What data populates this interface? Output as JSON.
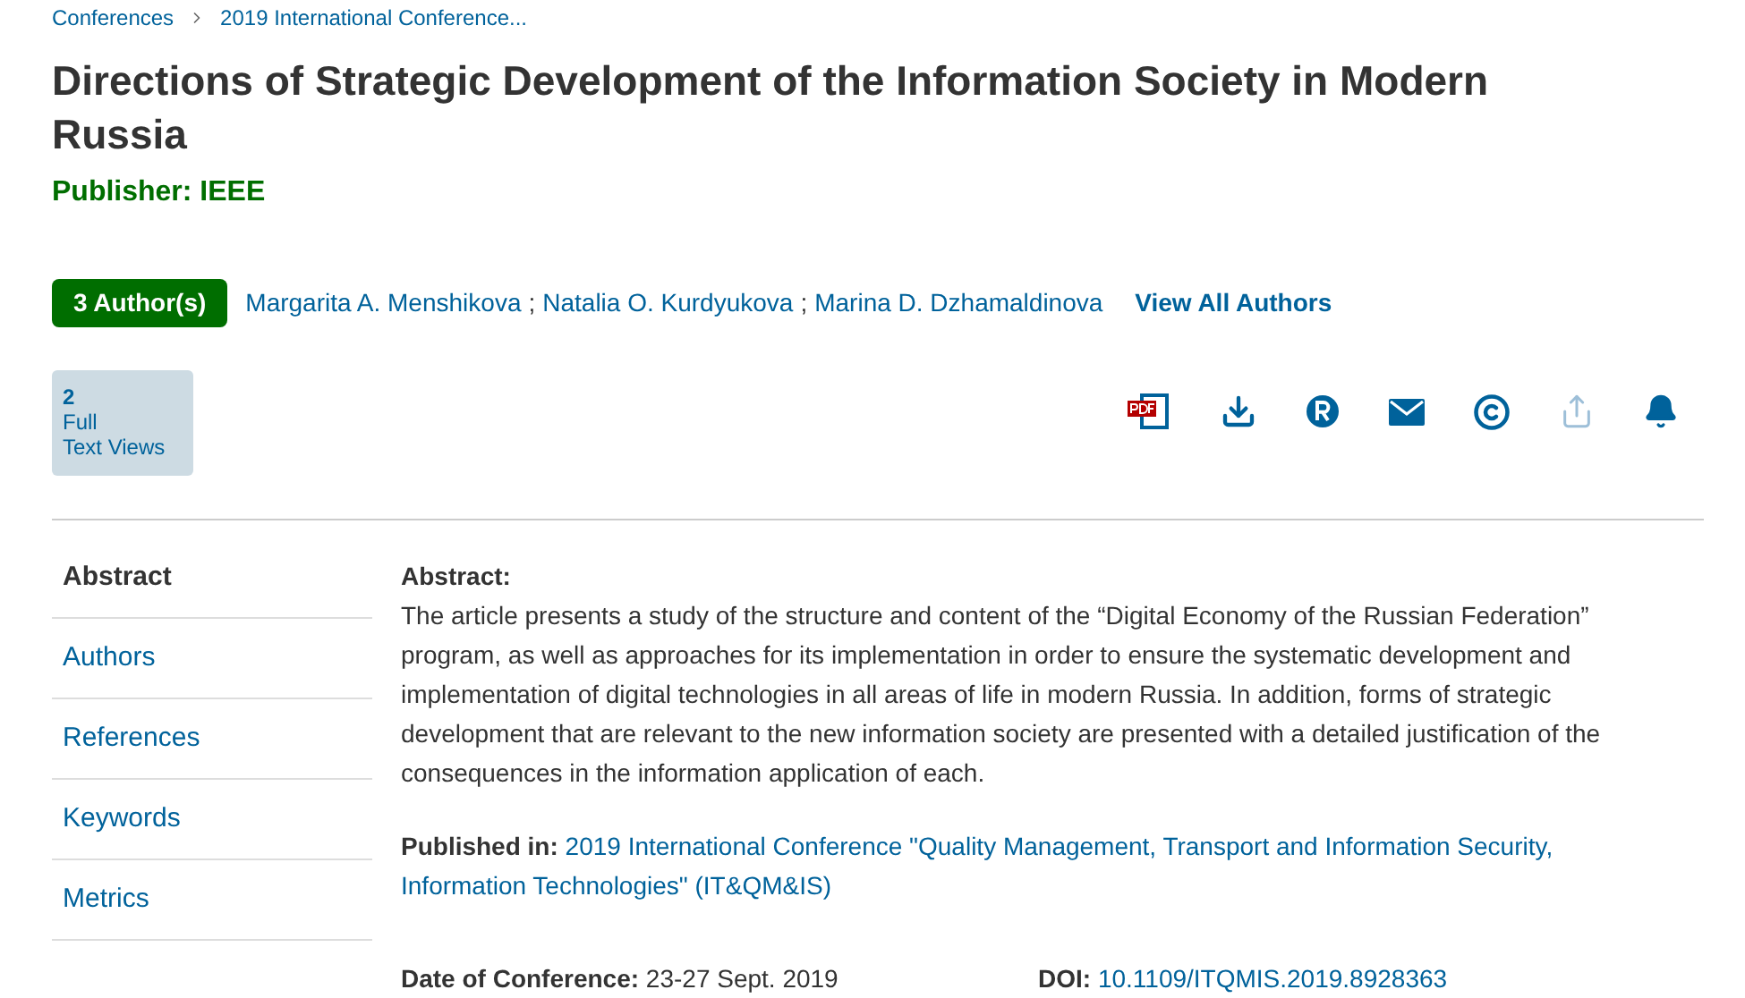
{
  "breadcrumb": [
    "Conferences",
    "2019 International Conference..."
  ],
  "title": "Directions of Strategic Development of the Information Society in Modern Russia",
  "publisher": "Publisher: IEEE",
  "authors_badge": "3 Author(s)",
  "authors": [
    "Margarita A. Menshikova",
    "Natalia O. Kurdyukova",
    "Marina D. Dzhamaldinova"
  ],
  "author_separator": ";",
  "view_all": "View All Authors",
  "metrics": {
    "count": "2",
    "label_1": "Full",
    "label_2": "Text Views"
  },
  "actions": [
    {
      "kind": "pdf",
      "disabled": false
    },
    {
      "kind": "download",
      "disabled": false
    },
    {
      "kind": "rights",
      "disabled": false
    },
    {
      "kind": "email",
      "disabled": false
    },
    {
      "kind": "copyright",
      "disabled": false
    },
    {
      "kind": "share",
      "disabled": true
    },
    {
      "kind": "alert",
      "disabled": false
    }
  ],
  "sidebar": {
    "items": [
      {
        "label": "Abstract",
        "selected": true
      },
      {
        "label": "Authors",
        "selected": false
      },
      {
        "label": "References",
        "selected": false
      },
      {
        "label": "Keywords",
        "selected": false
      },
      {
        "label": "Metrics",
        "selected": false
      }
    ]
  },
  "abstract": {
    "heading": "Abstract:",
    "text": "The article presents a study of the structure and content of the “Digital Economy of the Russian Federation” program, as well as approaches for its implementation in order to ensure the systematic development and implementation of digital technologies in all areas of life in modern Russia. In addition, forms of strategic development that are relevant to the new information society are presented with a detailed justification of the consequences in the information application of each."
  },
  "published_in": {
    "label": "Published in:",
    "value": "2019 International Conference \"Quality Management, Transport and Information Security, Information Technologies\" (IT&QM&IS)"
  },
  "date": {
    "label": "Date of Conference:",
    "value": "23-27 Sept. 2019"
  },
  "doi": {
    "label": "DOI:",
    "value": "10.1109/ITQMIS.2019.8928363"
  }
}
